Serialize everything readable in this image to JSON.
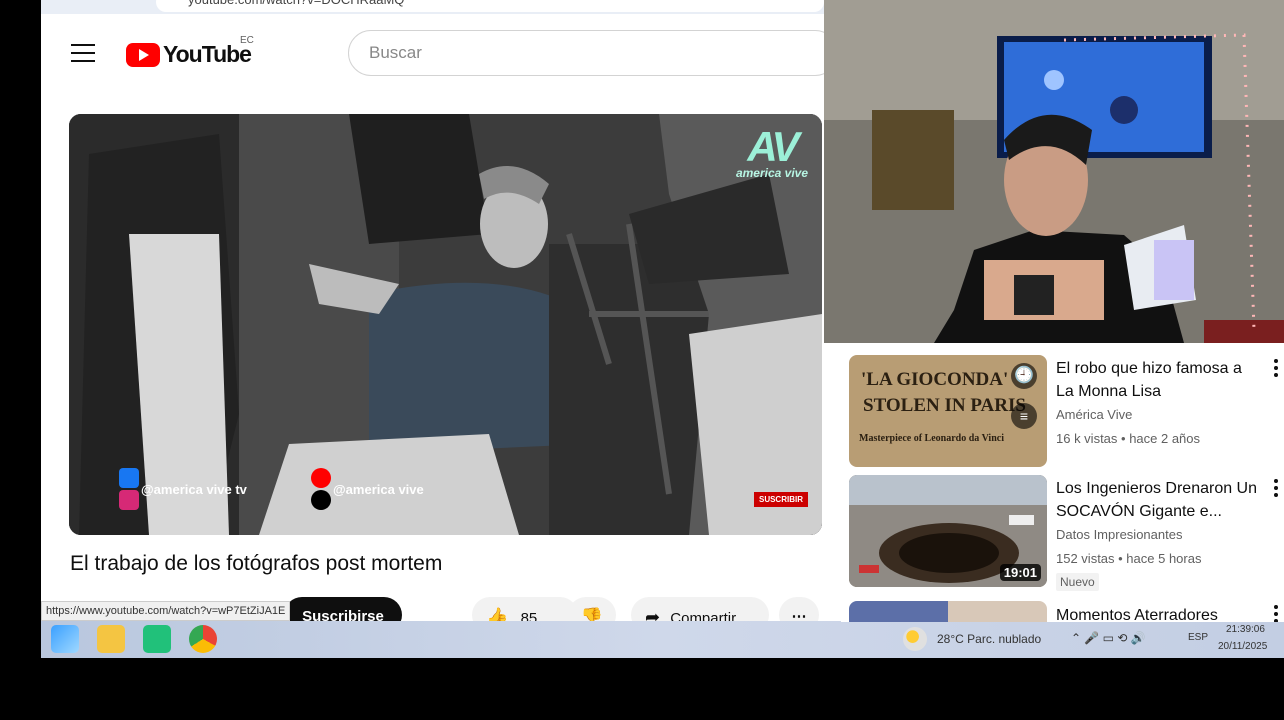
{
  "browser": {
    "url": "youtube.com/watch?v=DOCHRaaMQ"
  },
  "header": {
    "logo_text": "YouTube",
    "region": "EC",
    "search_placeholder": "Buscar"
  },
  "video": {
    "watermark_logo": "AV",
    "watermark_text": "america vive",
    "social_fb_ig": "@america vive tv",
    "social_yt_tt": "@america vive",
    "subscribe_overlay": "SUSCRIBIR",
    "title": "El trabajo de los fotógrafos post mortem",
    "subscribe_label": "Suscribirse",
    "likes": "85",
    "share_label": "Compartir"
  },
  "status_url": "https://www.youtube.com/watch?v=wP7EtZiJA1E",
  "recommendations": [
    {
      "title": "El robo que hizo famosa a La Monna Lisa",
      "channel": "América Vive",
      "meta": "16 k vistas • hace 2 años",
      "thumb_text_1": "'LA GIOCONDA'",
      "thumb_text_2": "STOLEN IN PARIS",
      "thumb_text_3": "Masterpiece of Leonardo da Vinci"
    },
    {
      "title": "Los Ingenieros Drenaron Un SOCAVÓN Gigante e...",
      "channel": "Datos Impresionantes",
      "meta": "152 vistas • hace 5 horas",
      "duration": "19:01",
      "badge": "Nuevo"
    },
    {
      "title": "Momentos Aterradores"
    }
  ],
  "taskbar": {
    "weather": "28°C  Parc. nublado",
    "lang": "ESP",
    "time": "21:39:06",
    "date": "20/11/2025"
  }
}
